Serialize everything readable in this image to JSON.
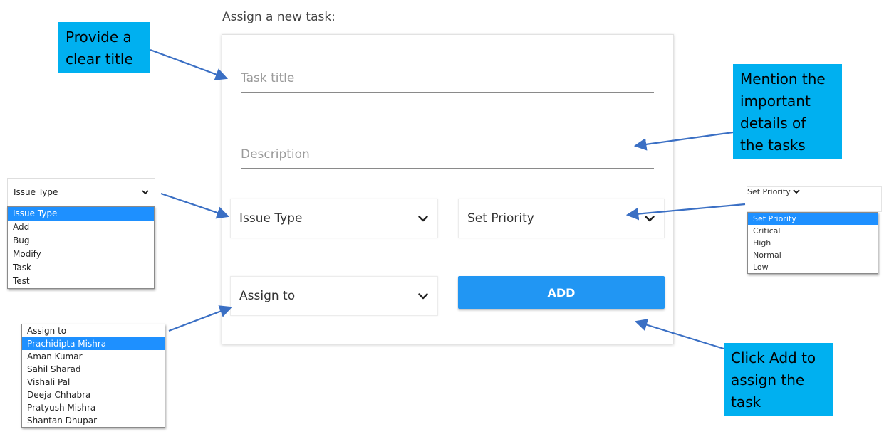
{
  "form": {
    "heading": "Assign a new task:",
    "title_placeholder": "Task title",
    "description_placeholder": "Description",
    "issue_type_label": "Issue Type",
    "priority_label": "Set Priority",
    "assign_label": "Assign to",
    "add_button": "ADD",
    "accent_color": "#2196f3"
  },
  "annotations": {
    "title_note": [
      "Provide a",
      "clear title"
    ],
    "description_note": [
      "Mention the",
      "important",
      "details of",
      "the tasks"
    ],
    "add_note": [
      "Click Add to",
      "assign the",
      "task"
    ],
    "callout_color": "#00b0f0"
  },
  "issue_type_dropdown": {
    "selected": "Issue Type",
    "options": [
      "Issue Type",
      "Add",
      "Bug",
      "Modify",
      "Task",
      "Test"
    ],
    "highlighted_index": 0
  },
  "priority_dropdown": {
    "selected": "Set Priority",
    "options": [
      "Set Priority",
      "Critical",
      "High",
      "Normal",
      "Low"
    ],
    "highlighted_index": 0
  },
  "assign_dropdown": {
    "options": [
      "Assign to",
      "Prachidipta Mishra",
      "Aman Kumar",
      "Sahil Sharad",
      "Vishali Pal",
      "Deeja Chhabra",
      "Pratyush Mishra",
      "Shantan Dhupar"
    ],
    "highlighted_index": 1
  }
}
